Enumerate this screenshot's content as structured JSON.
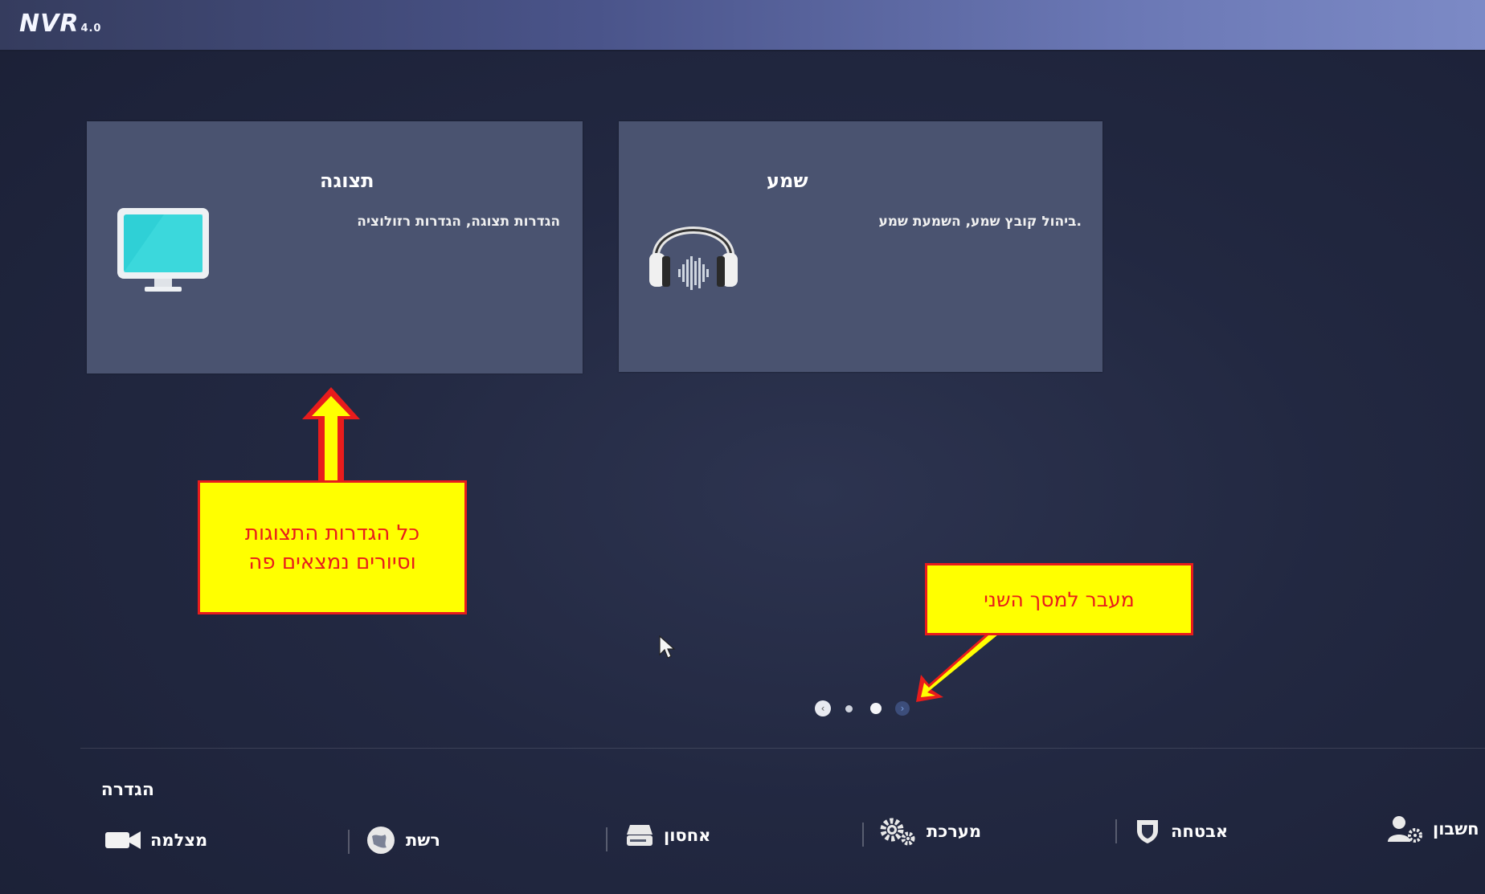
{
  "header": {
    "logo": "NVR",
    "version": "4.0"
  },
  "cards": [
    {
      "title": "תצוגה",
      "description": "הגדרות תצוגה, הגדרות רזולוציה",
      "icon": "monitor-icon"
    },
    {
      "title": "שמע",
      "description": ".ביהול קובץ שמע, השמעת שמע",
      "icon": "headphones-icon"
    }
  ],
  "pager": {
    "pages": 2,
    "current": 2,
    "prev_icon": "chevron-left-icon",
    "next_icon": "chevron-right-icon"
  },
  "settings": {
    "title": "הגדרה",
    "items": [
      {
        "label": "מצלמה",
        "icon": "camera-icon"
      },
      {
        "label": "רשת",
        "icon": "network-globe-icon"
      },
      {
        "label": "אחסון",
        "icon": "storage-icon"
      },
      {
        "label": "מערכת",
        "icon": "gears-icon"
      },
      {
        "label": "אבטחה",
        "icon": "shield-icon"
      },
      {
        "label": "חשבון",
        "icon": "account-icon"
      }
    ]
  },
  "annotations": {
    "callout1_line1": "כל הגדרות התצוגות",
    "callout1_line2": "וסיורים נמצאים פה",
    "callout2": "מעבר למסך השני",
    "accent_yellow": "#ffff00",
    "accent_red": "#e81c1c"
  }
}
